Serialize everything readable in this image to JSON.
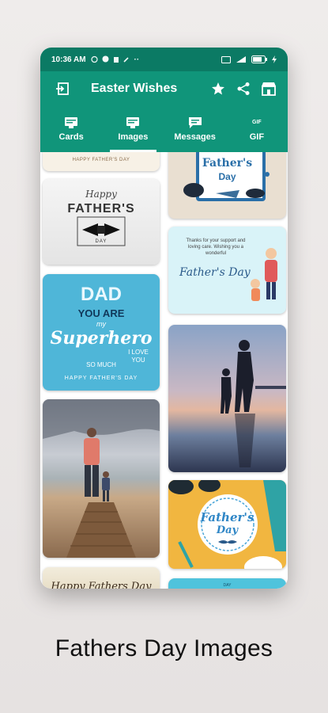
{
  "status": {
    "time": "10:36 AM"
  },
  "appbar": {
    "title": "Easter Wishes"
  },
  "tabs": [
    {
      "label": "Cards",
      "icon": "card-icon"
    },
    {
      "label": "Images",
      "icon": "image-icon"
    },
    {
      "label": "Messages",
      "icon": "message-icon"
    },
    {
      "label": "GIF",
      "icon": "gif-icon",
      "glyph": "GIF"
    }
  ],
  "cards": {
    "c1_text": "HAPPY FATHER'S DAY",
    "c2_title": "Father's",
    "c2_sub": "Day",
    "c3_happy": "Happy",
    "c3_fathers": "FATHER'S",
    "c3_day": "DAY",
    "c4_msg": "Thanks for your support and loving care. Wishing you a wonderful",
    "c4_script": "Father's Day",
    "c5_dad": "DAD",
    "c5_youare": "YOU ARE",
    "c5_my": "my",
    "c5_super": "Superhero",
    "c5_iloveyou": "I LOVE YOU",
    "c5_somuch": "SO MUCH",
    "c5_happy": "HAPPY FATHER'S DAY",
    "c8_fathers": "Father's",
    "c8_day": "Day",
    "c9_text": "Happy Fathers Day",
    "c10_text": "DAY"
  },
  "caption": "Fathers Day Images",
  "colors": {
    "statusbar": "#0b7a64",
    "toolbar": "#10957a",
    "accent_white": "#ffffff"
  }
}
